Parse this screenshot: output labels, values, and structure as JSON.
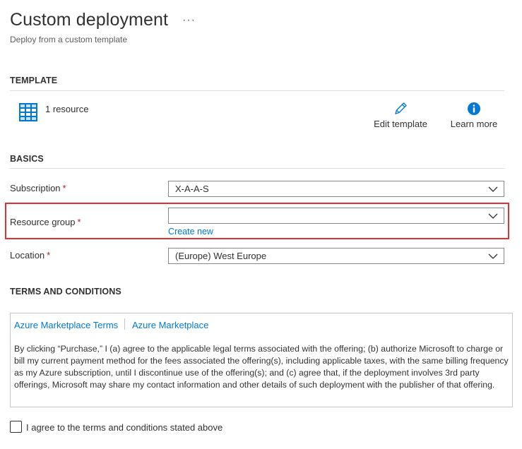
{
  "header": {
    "title": "Custom deployment",
    "more_label": "···",
    "subtitle": "Deploy from a custom template"
  },
  "template": {
    "heading": "TEMPLATE",
    "resource_count": "1 resource",
    "icon": "template-grid-icon",
    "edit_label": "Edit template",
    "learn_label": "Learn more"
  },
  "basics": {
    "heading": "BASICS",
    "subscription": {
      "label": "Subscription",
      "required": "*",
      "value": "X-A-A-S"
    },
    "resource_group": {
      "label": "Resource group",
      "required": "*",
      "value": "",
      "create_new": "Create new"
    },
    "location": {
      "label": "Location",
      "required": "*",
      "value": "(Europe) West Europe"
    }
  },
  "terms": {
    "heading": "TERMS AND CONDITIONS",
    "link1": "Azure Marketplace Terms",
    "link2": "Azure Marketplace",
    "body": "By clicking “Purchase,” I (a) agree to the applicable legal terms associated with the offering; (b) authorize Microsoft to charge or bill my current payment method for the fees associated the offering(s), including applicable taxes, with the same billing frequency as my Azure subscription, until I discontinue use of the offering(s); and (c) agree that, if the deployment involves 3rd party offerings, Microsoft may share my contact information and other details of such deployment with the publisher of that offering.",
    "agree_label": "I agree to the terms and conditions stated above",
    "agree_checked": false
  },
  "colors": {
    "link": "#0078d4",
    "required": "#a4262c",
    "highlight_border": "#e03131",
    "icon_blue": "#0078d4"
  }
}
